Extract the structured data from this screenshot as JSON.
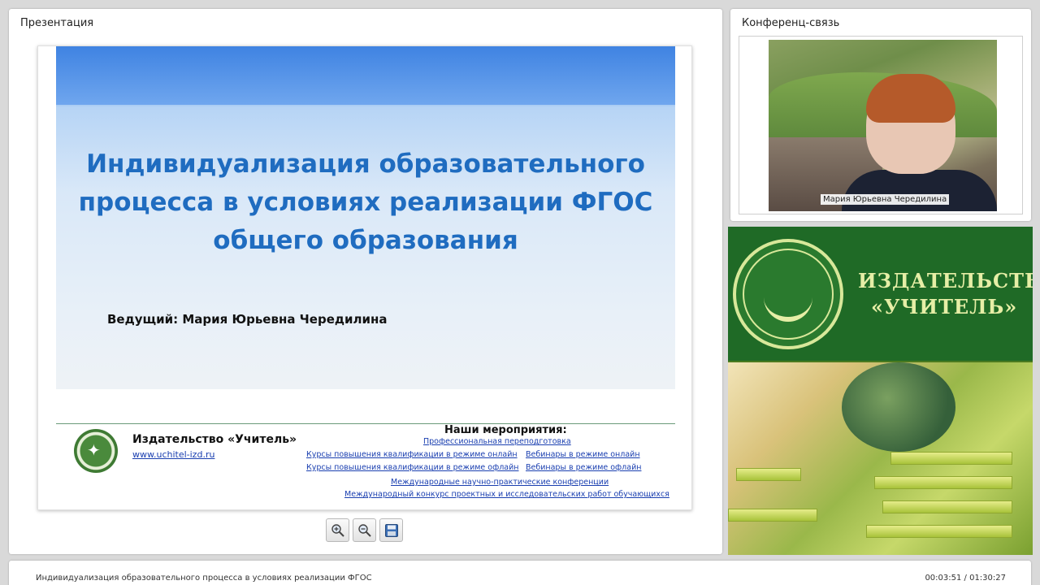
{
  "presentation_panel": {
    "title": "Презентация",
    "slide": {
      "title": "Индивидуализация образовательного процесса в условиях реализации ФГОС общего образования",
      "presenter": "Ведущий: Мария Юрьевна Чередилина",
      "footer": {
        "publisher": "Издательство «Учитель»",
        "url": "www.uchitel-izd.ru",
        "events_title": "Наши мероприятия:",
        "events": [
          "Профессиональная переподготовка",
          "Курсы повышения квалификации в режиме онлайн",
          "Вебинары в режиме онлайн",
          "Курсы повышения квалификации в режиме офлайн",
          "Вебинары в режиме офлайн",
          "Международные научно-практические конференции",
          "Международный конкурс проектных и исследовательских работ обучающихся"
        ]
      }
    },
    "tools": [
      "zoom-in-icon",
      "zoom-out-icon",
      "save-icon"
    ]
  },
  "conference_panel": {
    "title": "Конференц-связь",
    "participant_name": "Мария Юрьевна Чередилина"
  },
  "ad": {
    "line1": "ИЗДАТЕЛЬСТВО",
    "line2": "«УЧИТЕЛЬ»"
  },
  "bottom_bar": {
    "title": "Индивидуализация образовательного процесса в условиях реализации ФГОС",
    "time": "00:03:51 / 01:30:27"
  },
  "colors": {
    "slide_title": "#1f6cc0",
    "link": "#1a3fb0",
    "ad_green": "#1f6a26"
  }
}
